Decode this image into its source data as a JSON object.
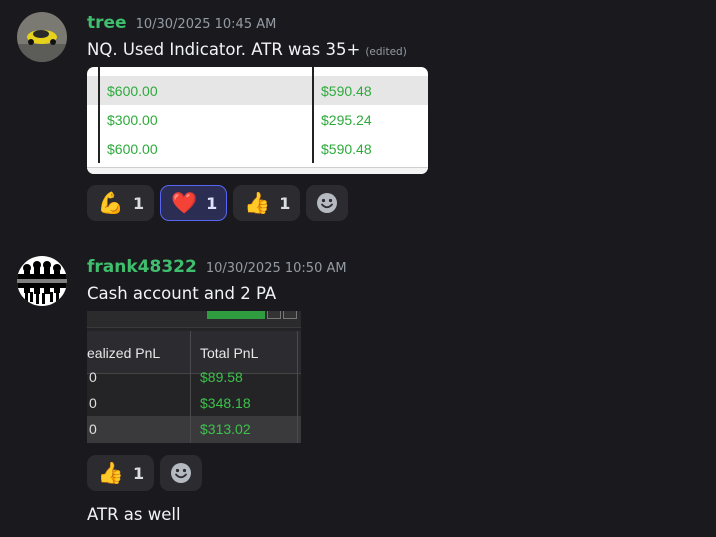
{
  "messages": [
    {
      "username": "tree",
      "timestamp": "10/30/2025 10:45 AM",
      "text": "NQ. Used Indicator. ATR was 35+",
      "edited_label": "(edited)",
      "attachment": {
        "rows": [
          {
            "left": "$600.00",
            "right": "$590.48"
          },
          {
            "left": "$300.00",
            "right": "$295.24"
          },
          {
            "left": "$600.00",
            "right": "$590.48"
          }
        ]
      },
      "reactions": [
        {
          "emoji": "💪",
          "icon": "flexed-biceps-icon",
          "count": "1"
        },
        {
          "emoji": "❤️",
          "icon": "red-heart-icon",
          "count": "1",
          "active": true
        },
        {
          "emoji": "👍",
          "icon": "thumbs-up-icon",
          "count": "1"
        }
      ]
    },
    {
      "username": "frank48322",
      "timestamp": "10/30/2025 10:50 AM",
      "text": "Cash account and 2 PA",
      "attachment": {
        "headers": [
          "ealized PnL",
          "Total PnL"
        ],
        "rows": [
          {
            "left": "0",
            "right": "$89.58"
          },
          {
            "left": "0",
            "right": "$348.18"
          },
          {
            "left": "0",
            "right": "$313.02"
          }
        ]
      },
      "reactions": [
        {
          "emoji": "👍",
          "icon": "thumbs-up-icon",
          "count": "1"
        }
      ]
    },
    {
      "text": "ATR as well"
    }
  ],
  "colors": {
    "background": "#1a1a1e",
    "username": "#3fbf6e",
    "timestamp": "#949ba4",
    "profit_green": "#2eaa3c",
    "reaction_active_border": "#5865f2"
  }
}
